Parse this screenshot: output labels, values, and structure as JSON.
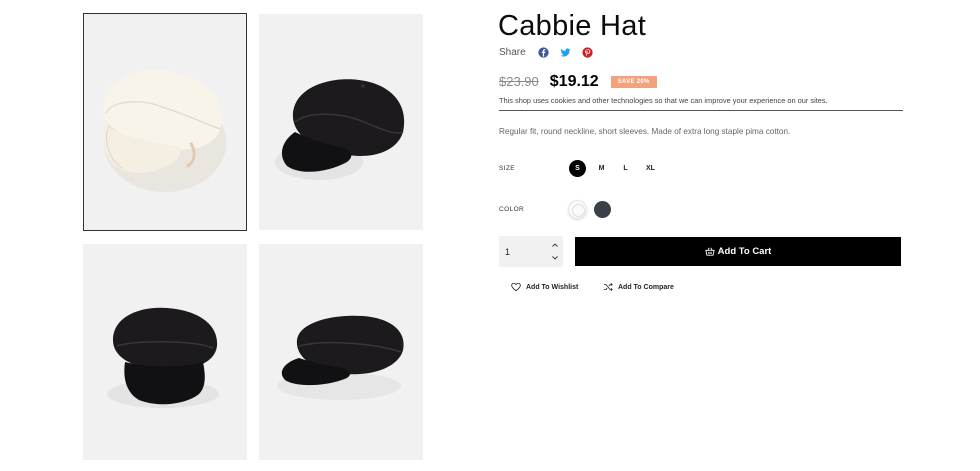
{
  "product": {
    "title": "Cabbie Hat",
    "old_price": "$23.90",
    "new_price": "$19.12",
    "sale_badge": "SAVE 20%",
    "description": "Regular fit, round neckline, short sleeves. Made of extra long staple pima cotton."
  },
  "share": {
    "label": "Share",
    "icons": [
      "facebook-icon",
      "twitter-icon",
      "pinterest-icon"
    ]
  },
  "cookie_notice": "This shop uses cookies and other technologies so that we can improve your experience on our sites.",
  "options": {
    "size_label": "SIZE",
    "sizes": [
      "S",
      "M",
      "L",
      "XL"
    ],
    "selected_size": "S",
    "color_label": "COLOR",
    "colors": [
      "#fafafa",
      "#3b4048"
    ]
  },
  "cart": {
    "quantity": "1",
    "add_to_cart": "Add To Cart"
  },
  "links": {
    "wishlist": "Add To Wishlist",
    "compare": "Add To Compare"
  },
  "colors": {
    "sale": "#f2a27c",
    "facebook": "#3b5998",
    "twitter": "#1da1f2",
    "pinterest": "#cb2027"
  }
}
